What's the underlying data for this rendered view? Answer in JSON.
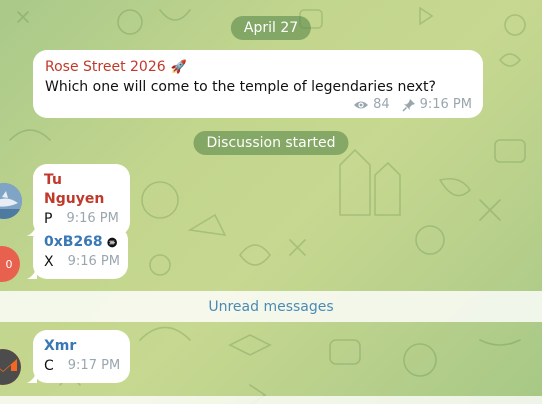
{
  "date_pill": "April 27",
  "channel_post": {
    "title": "Rose Street 2026",
    "title_emoji": "🚀",
    "text": "Which one will come to the temple of legendaries next?",
    "views": "84",
    "time": "9:16 PM"
  },
  "discussion_pill": "Discussion started",
  "messages": [
    {
      "sender": "Tu Nguyen",
      "sender_color": "#c0392b",
      "text": "P",
      "time": "9:16 PM"
    },
    {
      "sender": "0xB268",
      "sender_color": "#3a78b5",
      "text": "X",
      "time": "9:16 PM",
      "avatar_letter": "0"
    },
    {
      "sender": "Xmr",
      "sender_color": "#3a78b5",
      "text": "C",
      "time": "9:17 PM"
    }
  ],
  "unread_label": "Unread messages",
  "colors": {
    "accent_link": "#4a8bb5",
    "bubble": "#ffffff",
    "meta": "#9aa6ae"
  }
}
